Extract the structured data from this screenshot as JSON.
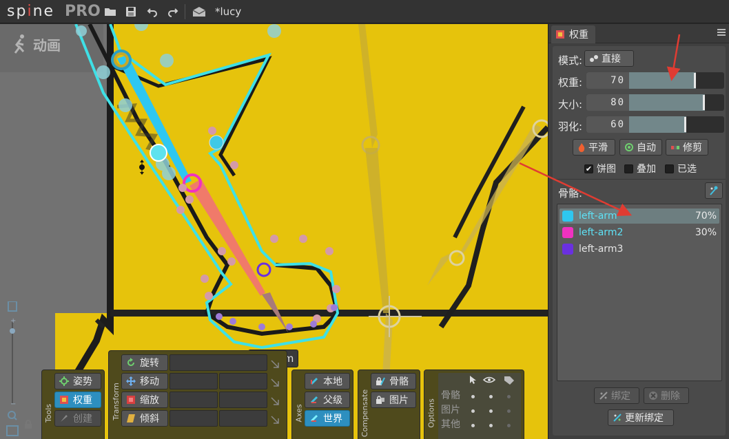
{
  "app": {
    "logo_text": "sp ne",
    "logo_pro": "PRO",
    "document_title": "*lucy",
    "toolbar_icons": [
      "open-folder-icon",
      "save-icon",
      "undo-icon",
      "redo-icon",
      "envelope-icon"
    ]
  },
  "viewport": {
    "mode_label": "动画",
    "selected_bone_tag": "left-arm",
    "background_color": "#e6c30c"
  },
  "tools": {
    "group_label": "Tools",
    "pose": "姿势",
    "weights": "权重",
    "create": "创建"
  },
  "transform": {
    "group_label": "Transform",
    "rotate": "旋转",
    "translate": "移动",
    "scale": "缩放",
    "shear": "倾斜"
  },
  "axes": {
    "group_label": "Axes",
    "local": "本地",
    "parent": "父级",
    "world": "世界"
  },
  "compensate": {
    "group_label": "Compensate",
    "bones": "骨骼",
    "images": "图片"
  },
  "options": {
    "group_label": "Options",
    "rows": [
      "骨骼",
      "图片",
      "其他"
    ]
  },
  "panel": {
    "tab_title": "权重",
    "mode_label": "模式:",
    "mode_value": "直接",
    "weight_label": "权重:",
    "weight_value": "70",
    "weight_fraction": 0.7,
    "size_label": "大小:",
    "size_value": "80",
    "size_fraction": 0.8,
    "feather_label": "羽化:",
    "feather_value": "60",
    "feather_fraction": 0.6,
    "smooth_button": "平滑",
    "auto_button": "自动",
    "prune_button": "修剪",
    "pie_check": "饼图",
    "overlay_check": "叠加",
    "selected_check": "已选",
    "bones_label": "骨骼:",
    "bones": [
      {
        "name": "left-arm",
        "percent": "70%",
        "color": "#2ec7f0"
      },
      {
        "name": "left-arm2",
        "percent": "30%",
        "color": "#f032c0"
      },
      {
        "name": "left-arm3",
        "percent": "",
        "color": "#6a30e0"
      }
    ],
    "bind_button": "绑定",
    "delete_button": "删除",
    "update_bind_button": "更新绑定"
  },
  "colors": {
    "accent_blue": "#2d8fbf",
    "annotation_red": "#e03c32",
    "mesh_cyan": "#3fe0e6"
  }
}
